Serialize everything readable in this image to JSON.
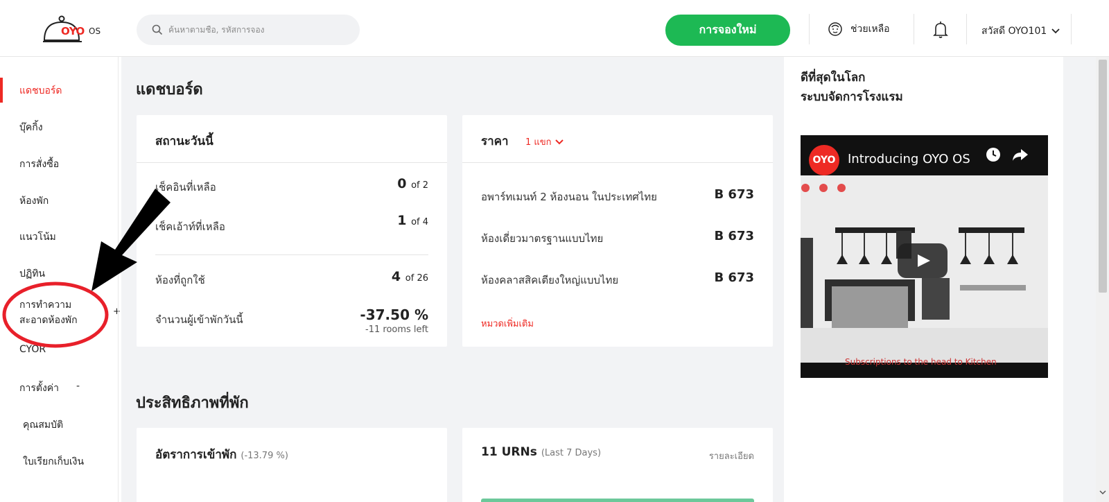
{
  "brand": {
    "logo_text": "OYO",
    "logo_suffix": "OS",
    "accent": "#ee2a24",
    "green": "#1db954"
  },
  "header": {
    "search_placeholder": "ค้นหาตามชื่อ, รหัสการจอง",
    "new_booking_label": "การจองใหม่",
    "help_label": "ช่วยเหลือ",
    "greeting": "สวัสดี OYO101"
  },
  "sidebar": {
    "items": [
      {
        "label": "แดชบอร์ด"
      },
      {
        "label": "บุ๊คกิ้ง"
      },
      {
        "label": "การสั่งซื้อ"
      },
      {
        "label": "ห้องพัก"
      },
      {
        "label": "แนวโน้ม"
      },
      {
        "label": "ปฏิทิน"
      },
      {
        "label_line1": "การทำความ",
        "label_line2": "สะอาดห้องพัก",
        "expander": "+"
      },
      {
        "label": "CYOR"
      },
      {
        "label": "การตั้งค่า",
        "expander": "-"
      },
      {
        "label": "คุณสมบัติ"
      },
      {
        "label": "ใบเรียกเก็บเงิน"
      }
    ]
  },
  "dashboard": {
    "title": "แดชบอร์ด",
    "today_status": {
      "title": "สถานะวันนี้",
      "rows": [
        {
          "label": "เช็คอินที่เหลือ",
          "value": "0",
          "of": "of 2"
        },
        {
          "label": "เช็คเอ้าท์ที่เหลือ",
          "value": "1",
          "of": "of 4"
        },
        {
          "label": "ห้องที่ถูกใช้",
          "value": "4",
          "of": "of 26"
        },
        {
          "label": "จำนวนผู้เข้าพักวันนี้",
          "value": "-37.50 %",
          "sub": "-11 rooms left"
        }
      ]
    },
    "price": {
      "title": "ราคา",
      "guest_selector": "1 แขก",
      "rows": [
        {
          "label": "อพาร์ทเมนท์ 2 ห้องนอน ในประเทศไทย",
          "value": "B 673"
        },
        {
          "label": "ห้องเดี่ยวมาตรฐานแบบไทย",
          "value": "B 673"
        },
        {
          "label": "ห้องคลาสสิคเตียงใหญ่แบบไทย",
          "value": "B 673"
        }
      ],
      "more_link": "หมวดเพิ่มเติม"
    }
  },
  "performance": {
    "title": "ประสิทธิภาพที่พัก",
    "occupancy": {
      "title": "อัตราการเข้าพัก",
      "change": "(-13.79 %)"
    },
    "urns": {
      "title": "11 URNs",
      "period": "(Last 7 Days)",
      "details_link": "รายละเอียด"
    }
  },
  "right_panel": {
    "title_line1": "ดีที่สุดในโลก",
    "title_line2": "ระบบจัดการโรงแรม",
    "video": {
      "channel_logo": "OYO",
      "title": "Introducing OYO OS",
      "caption": "Subscriptions to the head to Kitchen"
    }
  }
}
